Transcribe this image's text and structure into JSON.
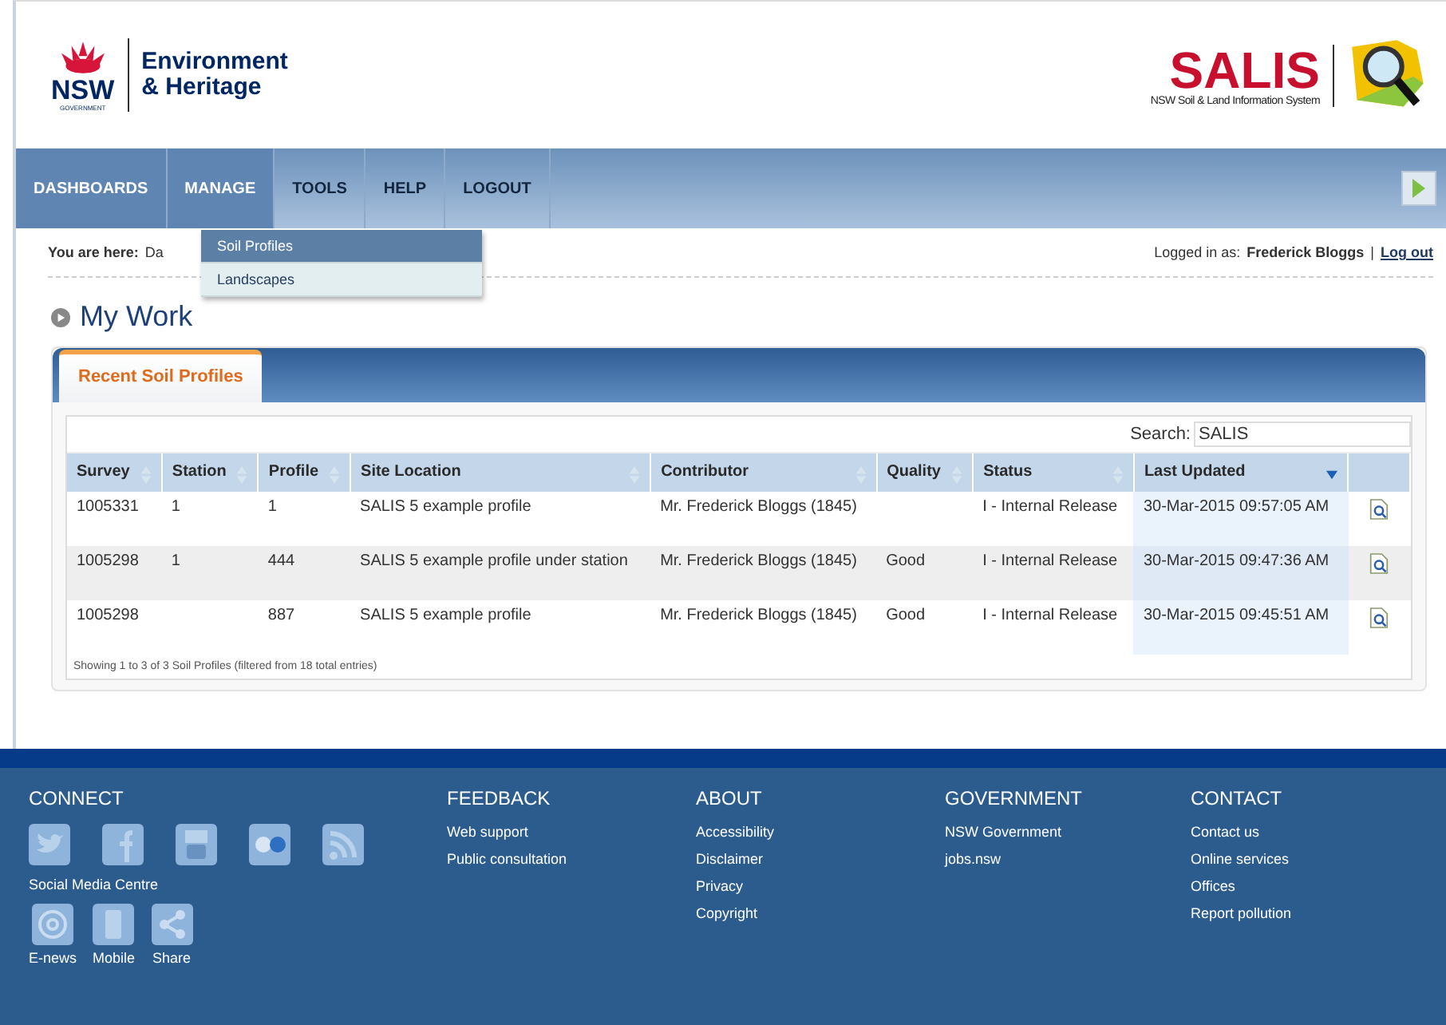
{
  "header": {
    "org_short": "NSW",
    "org_sub": "GOVERNMENT",
    "org_name": "Environment",
    "org_name2": "& Heritage",
    "app_name": "SALIS",
    "app_sub": "NSW Soil & Land Information System"
  },
  "nav": {
    "items": [
      {
        "label": "DASHBOARDS",
        "selected": true
      },
      {
        "label": "MANAGE",
        "selected": true
      },
      {
        "label": "TOOLS",
        "selected": false
      },
      {
        "label": "HELP",
        "selected": false
      },
      {
        "label": "LOGOUT",
        "selected": false
      }
    ]
  },
  "dropdown": {
    "items": [
      {
        "label": "Soil Profiles",
        "selected": true
      },
      {
        "label": "Landscapes",
        "selected": false
      }
    ]
  },
  "breadcrumb": {
    "label": "You are here:",
    "path": "Da"
  },
  "user": {
    "logged_in_label": "Logged in as:",
    "name": "Frederick Bloggs",
    "separator": "|",
    "logout": "Log out"
  },
  "page_title": "My Work",
  "panel": {
    "tabs": [
      {
        "label": "Recent Soil Profiles",
        "selected": true
      }
    ],
    "search": {
      "label": "Search:",
      "value": "SALIS"
    },
    "table": {
      "columns": [
        {
          "label": "Survey",
          "sorted": false
        },
        {
          "label": "Station",
          "sorted": false
        },
        {
          "label": "Profile",
          "sorted": false
        },
        {
          "label": "Site Location",
          "sorted": false
        },
        {
          "label": "Contributor",
          "sorted": false
        },
        {
          "label": "Quality",
          "sorted": false
        },
        {
          "label": "Status",
          "sorted": false
        },
        {
          "label": "Last Updated",
          "sorted": true
        }
      ],
      "rows": [
        {
          "cells": [
            "1005331",
            "1",
            "1",
            "SALIS 5 example profile",
            "Mr. Frederick Bloggs (1845)",
            "",
            "I - Internal Release",
            "30-Mar-2015 09:57:05 AM"
          ]
        },
        {
          "cells": [
            "1005298",
            "1",
            "444",
            "SALIS 5 example profile under station",
            "Mr. Frederick Bloggs (1845)",
            "Good",
            "I - Internal Release",
            "30-Mar-2015 09:47:36 AM"
          ]
        },
        {
          "cells": [
            "1005298",
            "",
            "887",
            "SALIS 5 example profile",
            "Mr. Frederick Bloggs (1845)",
            "Good",
            "I - Internal Release",
            "30-Mar-2015 09:45:51 AM"
          ]
        }
      ]
    },
    "info": "Showing 1 to 3 of 3 Soil Profiles (filtered from 18 total entries)"
  },
  "footer": {
    "connect": {
      "title": "CONNECT",
      "social_label": "Social Media Centre",
      "icons": [
        {
          "kind": "twitter"
        },
        {
          "kind": "facebook"
        },
        {
          "kind": "youtube"
        },
        {
          "kind": "flickr"
        },
        {
          "kind": "rss"
        }
      ],
      "links": [
        {
          "kind": "email",
          "label": "E-news"
        },
        {
          "kind": "mobile",
          "label": "Mobile"
        },
        {
          "kind": "share",
          "label": "Share"
        }
      ]
    },
    "columns": [
      {
        "title": "FEEDBACK",
        "links": [
          "Web support",
          "Public consultation"
        ]
      },
      {
        "title": "ABOUT",
        "links": [
          "Accessibility",
          "Disclaimer",
          "Privacy",
          "Copyright"
        ]
      },
      {
        "title": "GOVERNMENT",
        "links": [
          "NSW Government",
          "jobs.nsw"
        ]
      },
      {
        "title": "CONTACT",
        "links": [
          "Contact us",
          "Online services",
          "Offices",
          "Report pollution"
        ]
      }
    ]
  }
}
